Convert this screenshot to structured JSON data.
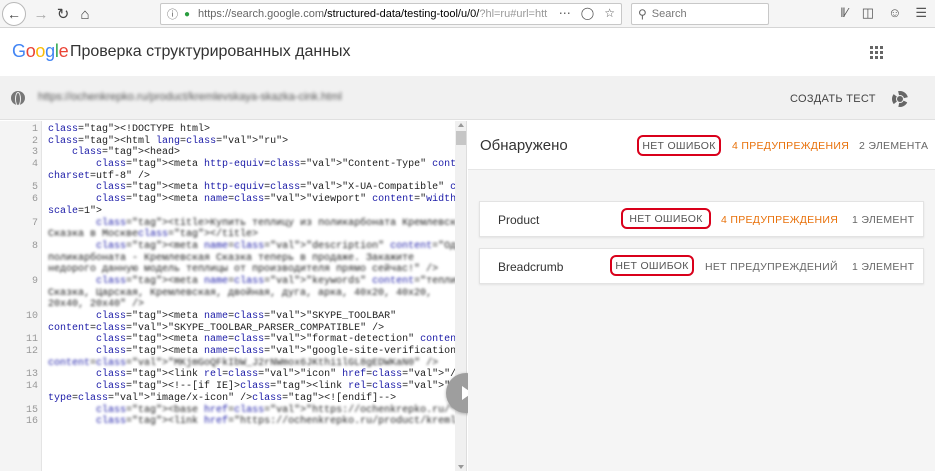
{
  "browser": {
    "url_host": "https://search.google.com",
    "url_path": "/structured-data/testing-tool/u/0/",
    "url_tail": "?hl=ru#url=http",
    "search_placeholder": "Search"
  },
  "app": {
    "logo": "Google",
    "title": "Проверка структурированных данных"
  },
  "url_row": {
    "tested_url": "https://ochenkrepko.ru/product/kremlevskaya-skazka-cink.html",
    "create_test": "СОЗДАТЬ ТЕСТ"
  },
  "code": {
    "lines": [
      {
        "n": "1",
        "t": "<!DOCTYPE html>"
      },
      {
        "n": "2",
        "t": "<html lang=\"ru\">"
      },
      {
        "n": "3",
        "t": "    <head>"
      },
      {
        "n": "4",
        "t": "        <meta http-equiv=\"Content-Type\" content=\"text/html;"
      },
      {
        "n": "",
        "t": "charset=utf-8\" />"
      },
      {
        "n": "5",
        "t": "        <meta http-equiv=\"X-UA-Compatible\" content=\"IE=edge\">"
      },
      {
        "n": "6",
        "t": "        <meta name=\"viewport\" content=\"width=device-width, initial-"
      },
      {
        "n": "",
        "t": "scale=1\">"
      },
      {
        "n": "7",
        "t": "        <title>Купить теплицу из поликарбоната Кремлевская Царская",
        "blur": true
      },
      {
        "n": "",
        "t": "Сказка в Москве</title>",
        "blur": true
      },
      {
        "n": "8",
        "t": "        <meta name=\"description\" content=\"Одна из лучших теплиц из",
        "blur": true
      },
      {
        "n": "",
        "t": "поликарбоната - Кремлевская Сказка теперь в продаже. Закажите",
        "blur": true
      },
      {
        "n": "",
        "t": "недорого данную модель теплицы от производителя прямо сейчас!\" />",
        "blur": true
      },
      {
        "n": "9",
        "t": "        <meta name=\"keywords\" content=\"теплицы, из поликарбоната,",
        "blur": true
      },
      {
        "n": "",
        "t": "Сказка, Царская, Кремлевская, двойная, дуга, арка, 40x20, 40x20,",
        "blur": true
      },
      {
        "n": "",
        "t": "20x40, 20x40\" />",
        "blur": true
      },
      {
        "n": "10",
        "t": "        <meta name=\"SKYPE_TOOLBAR\""
      },
      {
        "n": "",
        "t": "content=\"SKYPE_TOOLBAR_PARSER_COMPATIBLE\" />"
      },
      {
        "n": "11",
        "t": "        <meta name=\"format-detection\" content=\"telephone=no\" />"
      },
      {
        "n": "12",
        "t": "        <meta name=\"google-site-verification\""
      },
      {
        "n": "",
        "t": "content=\"MKjmGoQFkIbW_J2rNWmox6JKthi1lGL8gEDWKaN0\" />",
        "blur": true
      },
      {
        "n": "13",
        "t": "        <link rel=\"icon\" href=\"/favicon.ico\" type=\"image/x-icon\" />"
      },
      {
        "n": "14",
        "t": "        <!--[if IE]><link rel=\"shortcut icon\" href=\"/favicon.ico\""
      },
      {
        "n": "",
        "t": "type=\"image/x-icon\" /><![endif]-->"
      },
      {
        "n": "15",
        "t": "        <base href=\"https://ochenkrepko.ru/\" />",
        "blur": true
      },
      {
        "n": "16",
        "t": "        <link href=\"https://ochenkrepko.ru/product/kremlevskaya-",
        "blur": true
      }
    ]
  },
  "results": {
    "title": "Обнаружено",
    "summary": {
      "errors": "НЕТ ОШИБОК",
      "warnings": "4 ПРЕДУПРЕЖДЕНИЯ",
      "elements": "2 ЭЛЕМЕНТА"
    },
    "items": [
      {
        "name": "Product",
        "errors": "НЕТ ОШИБОК",
        "warnings": "4 ПРЕДУПРЕЖДЕНИЯ",
        "elements": "1 ЭЛЕМЕНТ"
      },
      {
        "name": "Breadcrumb",
        "errors": "НЕТ ОШИБОК",
        "warnings": "НЕТ ПРЕДУПРЕЖДЕНИЙ",
        "elements": "1 ЭЛЕМЕНТ"
      }
    ]
  },
  "colors": {
    "highlight": "#d9001b",
    "warning": "#e8710a"
  }
}
